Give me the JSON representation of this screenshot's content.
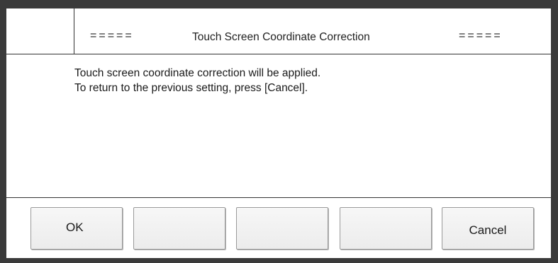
{
  "dialog": {
    "title_decoration_left": "=====",
    "title": "Touch Screen Coordinate Correction",
    "title_decoration_right": "=====",
    "message_lines": [
      "Touch screen coordinate correction will be applied.",
      "To return to the previous setting, press [Cancel]."
    ]
  },
  "buttons": {
    "ok_label": "OK",
    "button2_label": "",
    "button3_label": "",
    "button4_label": "",
    "cancel_label": "Cancel"
  },
  "colors": {
    "background": "#3a3a3a",
    "panel": "#ffffff",
    "border": "#333333",
    "button_face": "#f0f0f0"
  }
}
